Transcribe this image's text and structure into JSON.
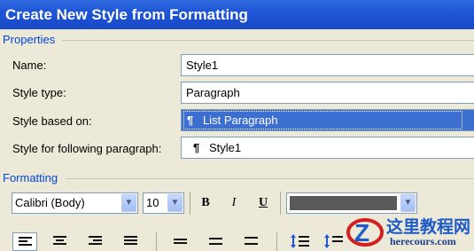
{
  "dialog": {
    "title": "Create New Style from Formatting"
  },
  "properties": {
    "section_label": "Properties",
    "name_label": "Name:",
    "name_value": "Style1",
    "type_label": "Style type:",
    "type_value": "Paragraph",
    "based_label": "Style based on:",
    "based_value": "List Paragraph",
    "following_label": "Style for following paragraph:",
    "following_value": "Style1"
  },
  "formatting": {
    "section_label": "Formatting",
    "font_value": "Calibri (Body)",
    "size_value": "10",
    "bold": "B",
    "italic": "I",
    "underline": "U",
    "font_color": "#5A5A5A"
  },
  "alignment_buttons": [
    "align-left-icon",
    "align-center-icon",
    "align-right-icon",
    "justify-icon",
    "single-spacing-icon",
    "one-half-spacing-icon",
    "double-spacing-icon",
    "space-before-icon",
    "space-after-icon"
  ],
  "watermark": {
    "site_name": "这里教程网",
    "site_url": "herecours.com"
  },
  "colors": {
    "title_bar": "#1E56D6",
    "section_label": "#0046D5",
    "selection": "#3D6FD1",
    "dialog_bg": "#ECE9D8"
  }
}
